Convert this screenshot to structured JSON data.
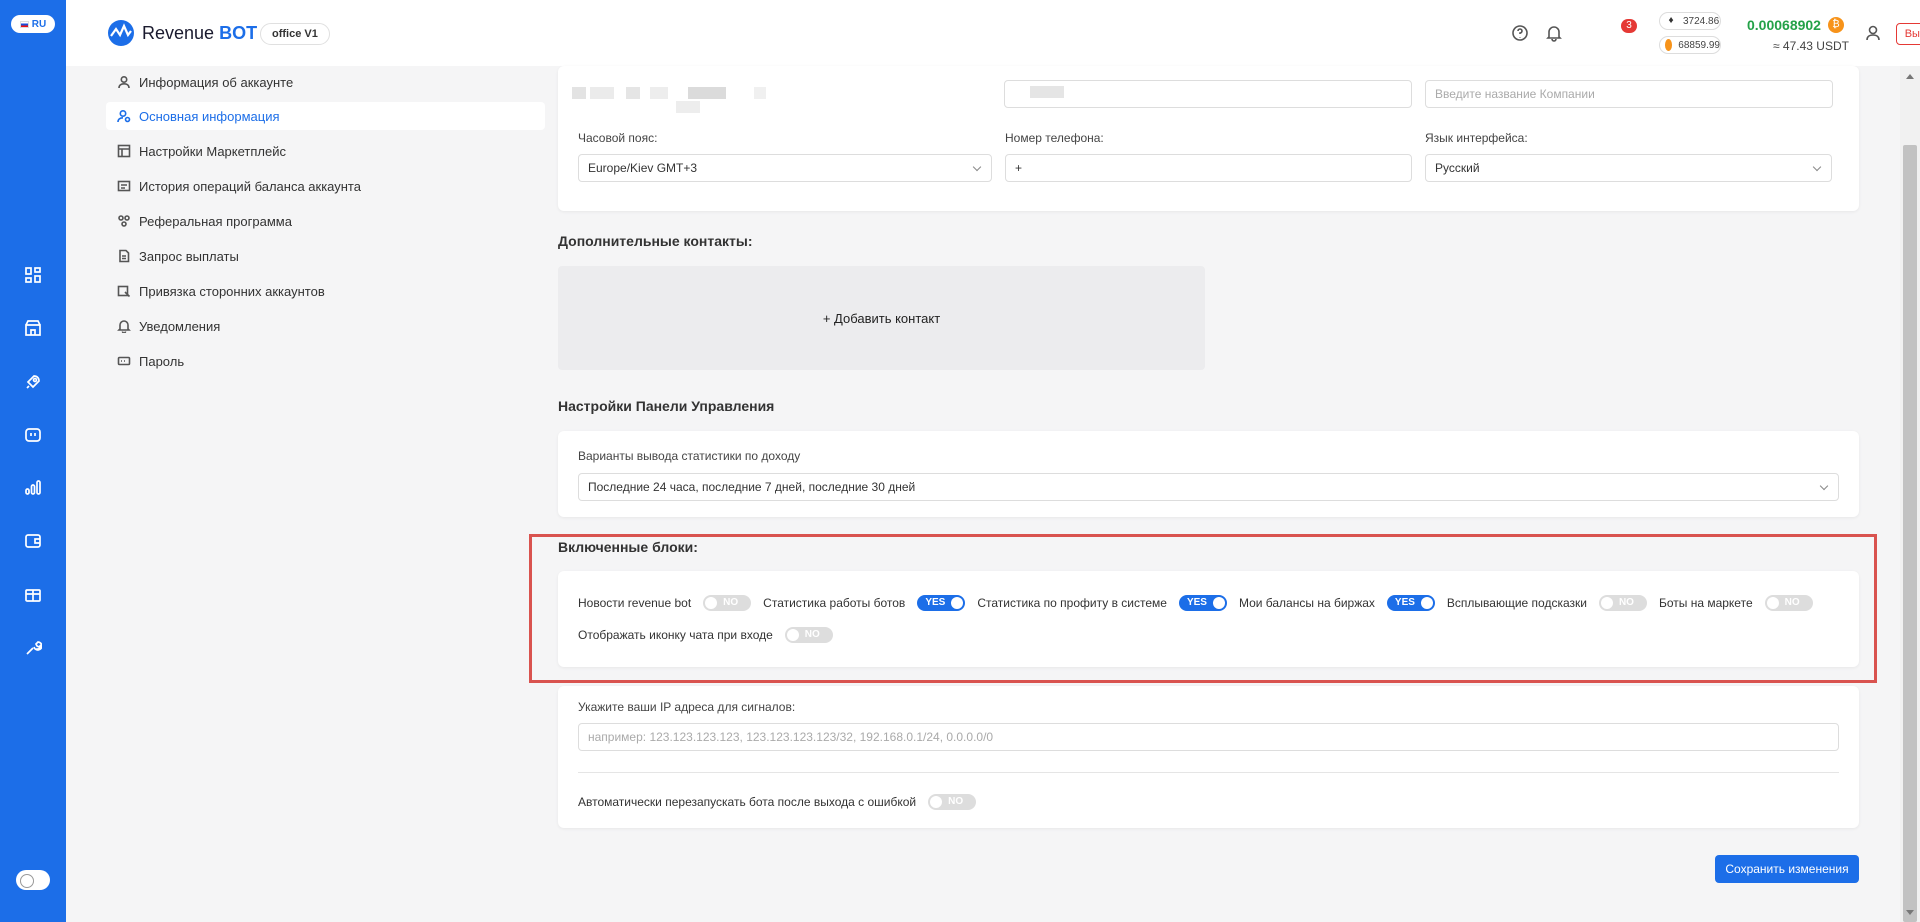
{
  "lang": {
    "code": "RU"
  },
  "header": {
    "logo_prefix": "Revenue",
    "logo_suffix": "BOT",
    "office_label": "office V1",
    "notification_count": "3",
    "eth_rate": "3724.86",
    "btc_rate": "68859.99",
    "balance_btc": "0.00068902",
    "balance_usdt": "≈ 47.43 USDT",
    "logout_label": "Выйти"
  },
  "sidebar": {
    "items": [
      {
        "label": "Информация об аккаунте",
        "icon": "user-icon"
      },
      {
        "label": "Основная информация",
        "icon": "user-settings-icon",
        "active": true
      },
      {
        "label": "Настройки Маркетплейс",
        "icon": "marketplace-icon"
      },
      {
        "label": "История операций баланса аккаунта",
        "icon": "history-icon"
      },
      {
        "label": "Реферальная программа",
        "icon": "referral-icon"
      },
      {
        "label": "Запрос выплаты",
        "icon": "payout-icon"
      },
      {
        "label": "Привязка сторонних аккаунтов",
        "icon": "link-accounts-icon"
      },
      {
        "label": "Уведомления",
        "icon": "bell-icon"
      },
      {
        "label": "Пароль",
        "icon": "password-icon"
      }
    ]
  },
  "basic_info": {
    "company_placeholder": "Введите название Компании",
    "timezone_label": "Часовой пояс:",
    "timezone_value": "Europe/Kiev GMT+3",
    "phone_label": "Номер телефона:",
    "phone_value": "+",
    "language_label": "Язык интерфейса:",
    "language_value": "Русский"
  },
  "contacts": {
    "title": "Дополнительные контакты:",
    "add_label": "+ Добавить контакт"
  },
  "dashboard": {
    "title": "Настройки Панели Управления",
    "stats_label": "Варианты вывода статистики по доходу",
    "stats_value": "Последние 24 часа, последние 7 дней, последние 30 дней"
  },
  "blocks": {
    "title": "Включенные блоки:",
    "toggles": [
      {
        "label": "Новости revenue bot",
        "state": "NO"
      },
      {
        "label": "Статистика работы ботов",
        "state": "YES"
      },
      {
        "label": "Статистика по профиту в системе",
        "state": "YES"
      },
      {
        "label": "Мои балансы на биржах",
        "state": "YES"
      },
      {
        "label": "Всплывающие подсказки",
        "state": "NO"
      },
      {
        "label": "Боты на маркете",
        "state": "NO"
      },
      {
        "label": "Отображать иконку чата при входе",
        "state": "NO"
      }
    ]
  },
  "signals": {
    "ip_label": "Укажите ваши IP адреса для сигналов:",
    "ip_placeholder": "например: 123.123.123.123, 123.123.123.123/32, 192.168.0.1/24, 0.0.0.0/0",
    "restart_label": "Автоматически перезапускать бота после выхода с ошибкой",
    "restart_state": "NO"
  },
  "save_label": "Сохранить изменения",
  "colors": {
    "accent": "#1c6ee8",
    "success": "#24a148",
    "danger": "#e53935"
  }
}
